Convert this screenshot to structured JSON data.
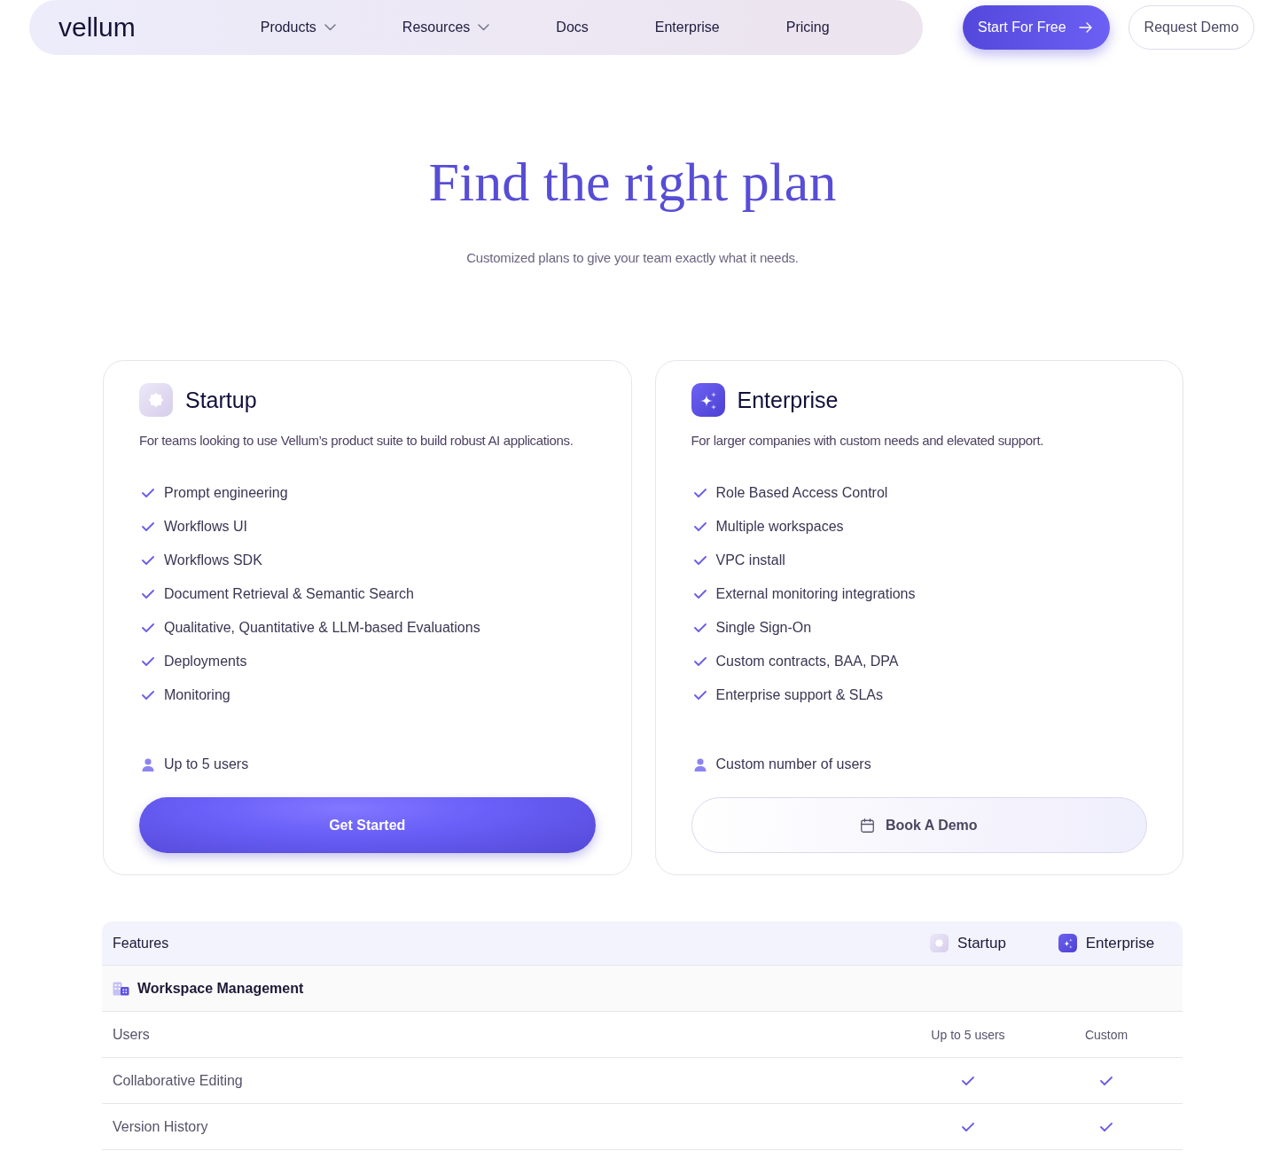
{
  "nav": {
    "logo": "vellum",
    "links": [
      {
        "label": "Products",
        "dropdown": true
      },
      {
        "label": "Resources",
        "dropdown": true
      },
      {
        "label": "Docs",
        "dropdown": false
      },
      {
        "label": "Enterprise",
        "dropdown": false
      },
      {
        "label": "Pricing",
        "dropdown": false
      }
    ],
    "buttons": [
      {
        "label": "Start For Free",
        "kind": "primary"
      },
      {
        "label": "Request Demo",
        "kind": "secondary"
      }
    ]
  },
  "hero": {
    "title": "Find the right plan",
    "subtitle": "Customized plans to give your team exactly what it needs."
  },
  "plans": [
    {
      "kind": "startup",
      "name": "Startup",
      "description": "For teams looking to use Vellum’s product suite to build robust AI applications.",
      "features": [
        "Prompt engineering",
        "Workflows UI",
        "Workflows SDK",
        "Document Retrieval & Semantic Search",
        "Qualitative, Quantitative & LLM-based Evaluations",
        "Deployments",
        "Monitoring"
      ],
      "users": "Up to 5 users",
      "button": {
        "label": "Get Started",
        "kind": "primary"
      }
    },
    {
      "kind": "enterprise",
      "name": "Enterprise",
      "description": "For larger companies with custom needs and elevated support.",
      "features": [
        "Role Based Access Control",
        "Multiple workspaces",
        "VPC install",
        "External monitoring integrations",
        "Single Sign-On",
        "Custom contracts, BAA, DPA",
        "Enterprise support & SLAs"
      ],
      "users": "Custom number of users",
      "button": {
        "label": "Book A Demo",
        "kind": "secondary"
      }
    }
  ],
  "comparison": {
    "columns": [
      {
        "label": "Features",
        "kind": "feature"
      },
      {
        "label": "Startup",
        "kind": "startup"
      },
      {
        "label": "Enterprise",
        "kind": "enterprise"
      }
    ],
    "sections": [
      {
        "title": "Workspace Management",
        "rows": [
          {
            "feature": "Users",
            "values": [
              {
                "kind": "text",
                "text": "Up to 5 users"
              },
              {
                "kind": "text",
                "text": "Custom"
              }
            ]
          },
          {
            "feature": "Collaborative Editing",
            "values": [
              {
                "kind": "check",
                "included": true
              },
              {
                "kind": "check",
                "included": true
              }
            ]
          },
          {
            "feature": "Version History",
            "values": [
              {
                "kind": "check",
                "included": true
              },
              {
                "kind": "check",
                "included": true
              }
            ]
          }
        ]
      }
    ]
  }
}
